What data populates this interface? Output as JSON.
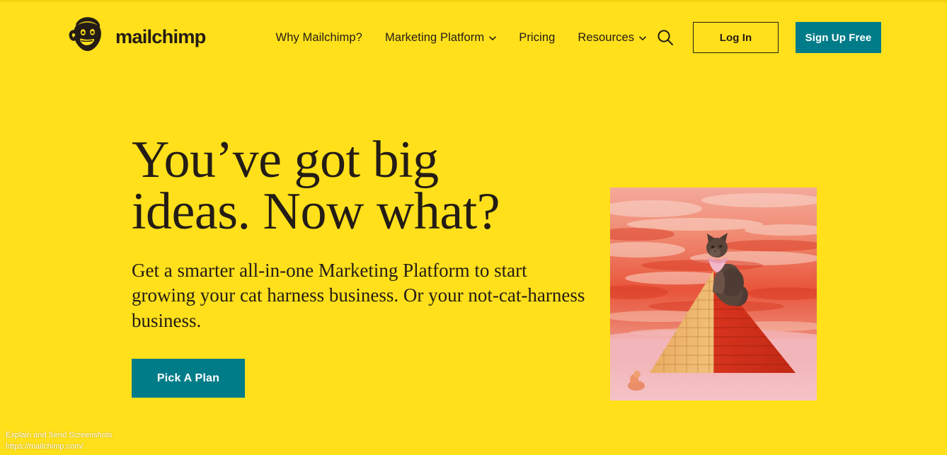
{
  "theme": {
    "background": "#FFE01B",
    "ink": "#241C15",
    "accent_teal": "#007C89",
    "top_edge": "#F5D312"
  },
  "header": {
    "brand_name": "mailchimp",
    "logo_icon": "freddie-monkey-logo",
    "nav": [
      {
        "label": "Why Mailchimp?",
        "has_dropdown": false
      },
      {
        "label": "Marketing Platform",
        "has_dropdown": true
      },
      {
        "label": "Pricing",
        "has_dropdown": false
      },
      {
        "label": "Resources",
        "has_dropdown": true
      }
    ],
    "search_icon": "search-icon",
    "login_label": "Log In",
    "signup_label": "Sign Up Free"
  },
  "hero": {
    "title_line_1": "You’ve got big",
    "title_line_2": "ideas. Now what?",
    "subtitle": "Get a smarter all-in-one Marketing Platform to start growing your cat harness business. Or your not-cat-harness business.",
    "cta_label": "Pick A Plan",
    "image_alt": "cat-on-pyramid-photo"
  },
  "status": {
    "tool_label": "Explain and Send Screenshots",
    "url": "https://mailchimp.com/"
  }
}
